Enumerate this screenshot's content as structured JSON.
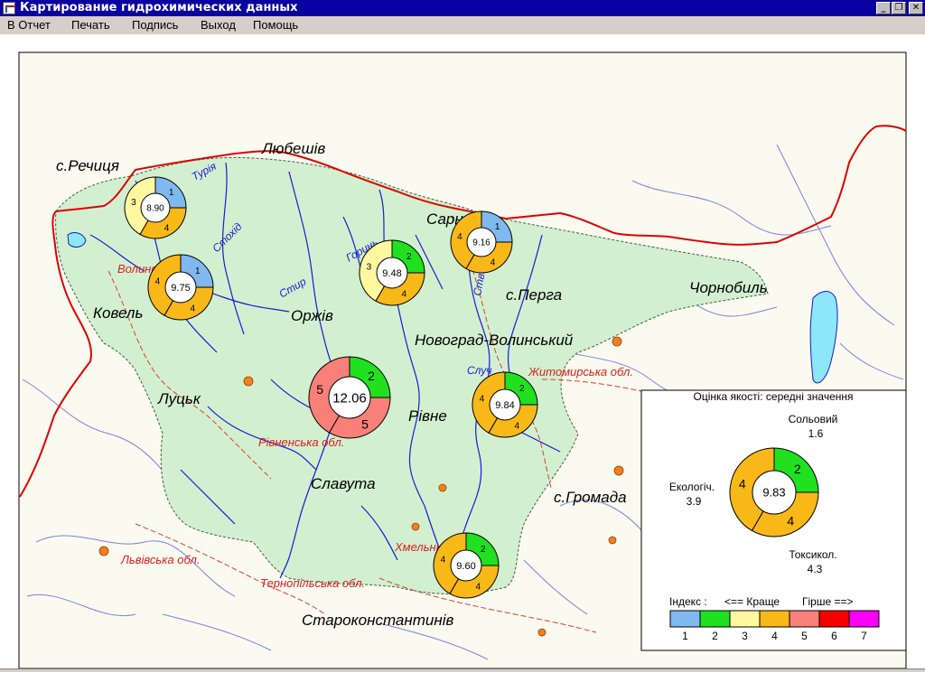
{
  "window": {
    "title": "Картирование гидрохимических данных",
    "minimize_glyph": "_",
    "restore_glyph": "❐",
    "close_glyph": "✕"
  },
  "menu": [
    "В Отчет",
    "Печать",
    "Подпись",
    "Выход",
    "Помощь"
  ],
  "map": {
    "cities": [
      "с.Речиця",
      "Любешів",
      "Ковель",
      "Оржів",
      "Сарни",
      "с.Перга",
      "Чорнобиль",
      "Новоград-Волинський",
      "Луцьк",
      "Рівне",
      "Славута",
      "с.Громада",
      "Староконстантинів"
    ],
    "regions": [
      "Волинська обл.",
      "Житомирська обл.",
      "Рівненська обл.",
      "Хмельницька обл.",
      "Львівська обл.",
      "Тернопільська обл."
    ],
    "rivers": [
      "Турія",
      "Стохід",
      "Стир",
      "Горинь",
      "Случ",
      "Ствига"
    ],
    "stations": [
      {
        "value": "8.90",
        "counts": [
          "1",
          "4",
          "3"
        ]
      },
      {
        "value": "9.75",
        "counts": [
          "1",
          "4",
          "4"
        ]
      },
      {
        "value": "9.48",
        "counts": [
          "2",
          "4",
          "3"
        ]
      },
      {
        "value": "9.16",
        "counts": [
          "1",
          "4",
          "4"
        ]
      },
      {
        "value": "12.06",
        "counts": [
          "2",
          "5",
          "5"
        ]
      },
      {
        "value": "9.84",
        "counts": [
          "2",
          "4",
          "4"
        ]
      },
      {
        "value": "9.60",
        "counts": [
          "2",
          "4",
          "4"
        ]
      }
    ]
  },
  "legend": {
    "title": "Оцінка якості: середні значення",
    "center_value": "9.83",
    "salt_label": "Сольовий",
    "salt_value": "1.6",
    "salt_class": "2",
    "ecol_label": "Екологіч.",
    "ecol_value": "3.9",
    "ecol_class": "4",
    "toxic_label": "Токсикол.",
    "toxic_value": "4.3",
    "toxic_class": "4",
    "index_caption": "Індекс :",
    "better": "<== Краще",
    "worse": "Гірше ==>",
    "classes": [
      {
        "n": "1",
        "color": "#80b8f0"
      },
      {
        "n": "2",
        "color": "#20e020"
      },
      {
        "n": "3",
        "color": "#fff8a0"
      },
      {
        "n": "4",
        "color": "#f8b818"
      },
      {
        "n": "5",
        "color": "#f88078"
      },
      {
        "n": "6",
        "color": "#f80000"
      },
      {
        "n": "7",
        "color": "#f800f8"
      }
    ]
  },
  "colors": {
    "basin": "#d2f0d0",
    "river": "#1a1ad0",
    "border": "#e00000",
    "lake": "#8ce8f8",
    "town": "#f08020"
  }
}
